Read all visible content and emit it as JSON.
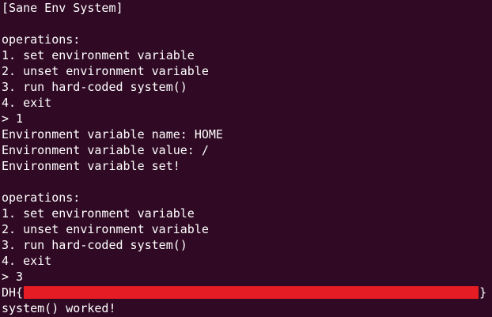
{
  "terminal": {
    "background": "#300a24",
    "foreground": "#ffffff",
    "lines": {
      "title": "[Sane Env System]",
      "blank1": "",
      "ops_header_1": "operations:",
      "op1_1": "1. set environment variable",
      "op2_1": "2. unset environment variable",
      "op3_1": "3. run hard-coded system()",
      "op4_1": "4. exit",
      "prompt_1": "> 1",
      "var_name": "Environment variable name: HOME",
      "var_value": "Environment variable value: /",
      "var_set": "Environment variable set!",
      "blank2": "",
      "ops_header_2": "operations:",
      "op1_2": "1. set environment variable",
      "op2_2": "2. unset environment variable",
      "op3_2": "3. run hard-coded system()",
      "op4_2": "4. exit",
      "prompt_2": "> 3",
      "flag_prefix": "DH{",
      "flag_suffix": "}",
      "system_worked": "system() worked!"
    },
    "redaction_color": "#e51c23"
  }
}
